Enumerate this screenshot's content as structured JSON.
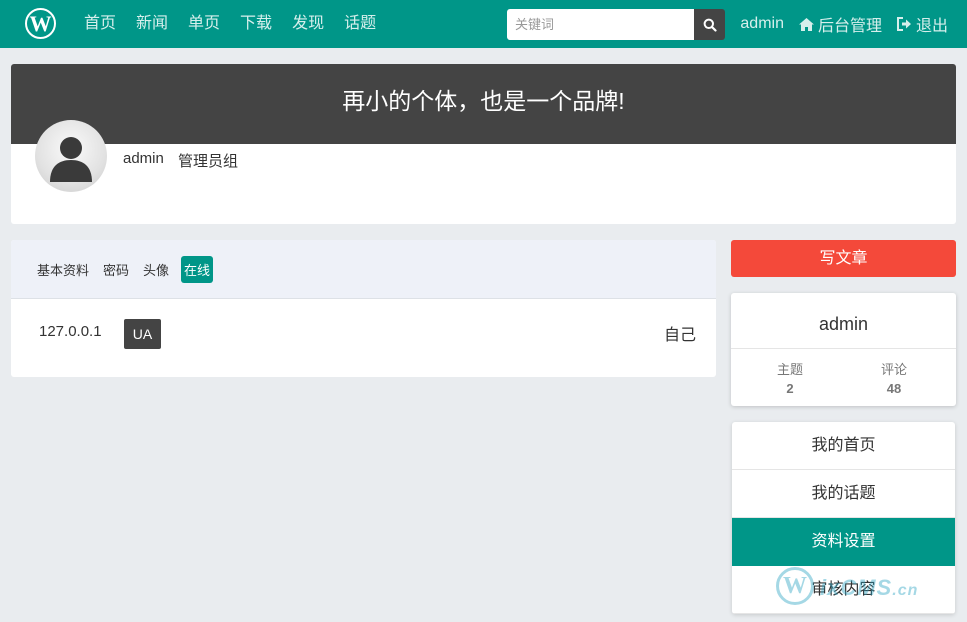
{
  "navbar": {
    "logo": "W",
    "links": [
      "首页",
      "新闻",
      "单页",
      "下载",
      "发现",
      "话题"
    ],
    "search_placeholder": "关键词",
    "user": "admin",
    "admin_label": "后台管理",
    "logout_label": "退出"
  },
  "profile": {
    "slogan": "再小的个体，也是一个品牌!",
    "username": "admin",
    "group": "管理员组"
  },
  "tabs": [
    "基本资料",
    "密码",
    "头像",
    "在线"
  ],
  "active_tab": "在线",
  "session": {
    "ip": "127.0.0.1",
    "badge": "UA",
    "owner": "自己"
  },
  "sidebar": {
    "write_button": "写文章",
    "stats_name": "admin",
    "topics_label": "主题",
    "topics_value": "2",
    "comments_label": "评论",
    "comments_value": "48",
    "menu": [
      "我的首页",
      "我的话题",
      "资料设置",
      "审核内容"
    ],
    "active_menu": "资料设置"
  },
  "watermark": {
    "logo": "W",
    "text": "ixCMS",
    "suffix": ".cn"
  },
  "colors": {
    "primary": "#009688",
    "dark": "#444444",
    "danger": "#f4493a",
    "background": "#e9ecef"
  }
}
